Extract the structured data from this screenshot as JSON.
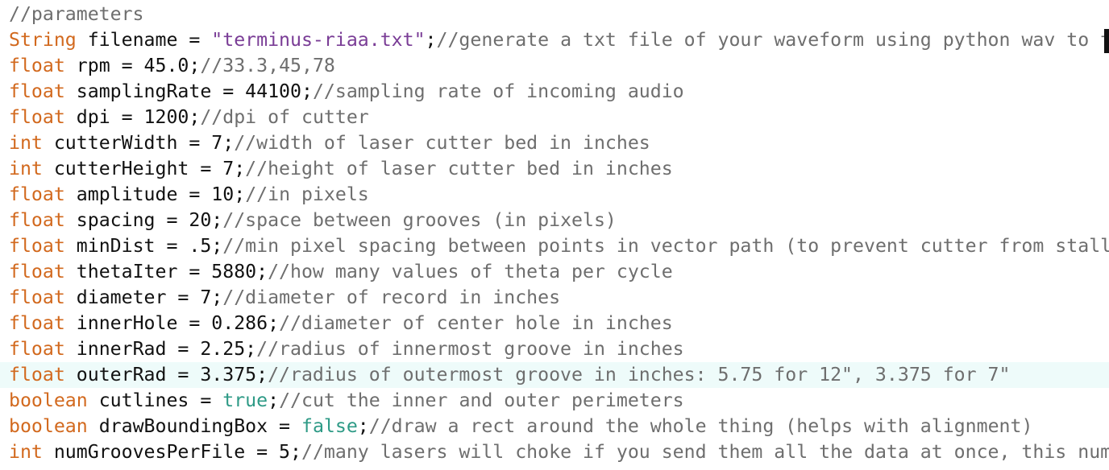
{
  "editor": {
    "current_line_index": 14,
    "lines": [
      {
        "comment": "//parameters"
      },
      {
        "kw": "String",
        "decl": " filename = ",
        "value": "\"terminus-riaa.txt\"",
        "value_type": "string",
        "end": ";",
        "comment": "//generate a txt file of your waveform using python wav to t"
      },
      {
        "kw": "float",
        "decl": " rpm = 45.0;",
        "comment": "//33.3,45,78"
      },
      {
        "kw": "float",
        "decl": " samplingRate = 44100;",
        "comment": "//sampling rate of incoming audio"
      },
      {
        "kw": "float",
        "decl": " dpi = 1200;",
        "comment": "//dpi of cutter"
      },
      {
        "kw": "int",
        "decl": " cutterWidth = 7;",
        "comment": "//width of laser cutter bed in inches"
      },
      {
        "kw": "int",
        "decl": " cutterHeight = 7;",
        "comment": "//height of laser cutter bed in inches"
      },
      {
        "kw": "float",
        "decl": " amplitude = 10;",
        "comment": "//in pixels"
      },
      {
        "kw": "float",
        "decl": " spacing = 20;",
        "comment": "//space between grooves (in pixels)"
      },
      {
        "kw": "float",
        "decl": " minDist = .5;",
        "comment": "//min pixel spacing between points in vector path (to prevent cutter from stall"
      },
      {
        "kw": "float",
        "decl": " thetaIter = 5880;",
        "comment": "//how many values of theta per cycle"
      },
      {
        "kw": "float",
        "decl": " diameter = 7;",
        "comment": "//diameter of record in inches"
      },
      {
        "kw": "float",
        "decl": " innerHole = 0.286;",
        "comment": "//diameter of center hole in inches"
      },
      {
        "kw": "float",
        "decl": " innerRad = 2.25;",
        "comment": "//radius of innermost groove in inches"
      },
      {
        "kw": "float",
        "decl": " outerRad = 3.375;",
        "comment": "//radius of outermost groove in inches: 5.75 for 12\", 3.375 for 7\""
      },
      {
        "kw": "boolean",
        "decl": " cutlines = ",
        "value": "true",
        "value_type": "bool",
        "end": ";",
        "comment": "//cut the inner and outer perimeters"
      },
      {
        "kw": "boolean",
        "decl": " drawBoundingBox = ",
        "value": "false",
        "value_type": "bool",
        "end": ";",
        "comment": "//draw a rect around the whole thing (helps with alignment)"
      },
      {
        "kw": "int",
        "decl": " numGroovesPerFile = 5;",
        "comment": "//many lasers will choke if you send them all the data at once, this num"
      }
    ]
  },
  "colors": {
    "keyword": "#d2691e",
    "string": "#7a3d96",
    "boolean": "#2e9a86",
    "comment": "#6e6e6e",
    "text": "#111111",
    "current_line_bg": "#eefbfa"
  }
}
